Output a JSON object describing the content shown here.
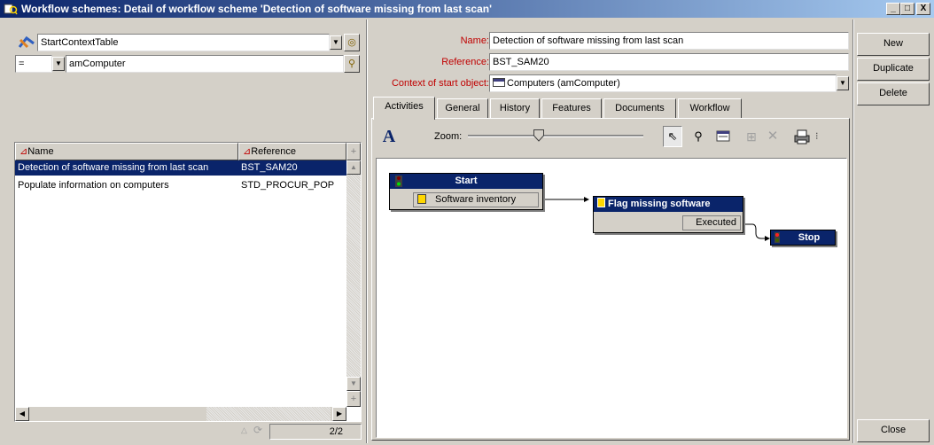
{
  "window": {
    "title": "Workflow schemes: Detail of workflow scheme 'Detection of software missing from last scan'",
    "controls": {
      "minimize": "_",
      "maximize": "□",
      "close": "X"
    }
  },
  "filter": {
    "table_value": "StartContextTable",
    "operator": "=",
    "value": "amComputer"
  },
  "list": {
    "columns": [
      "Name",
      "Reference"
    ],
    "rows": [
      {
        "name": "Detection of software missing from last scan",
        "reference": "BST_SAM20",
        "selected": true
      },
      {
        "name": "Populate information on computers",
        "reference": "STD_PROCUR_POP",
        "selected": false
      }
    ],
    "count": "2/2"
  },
  "detail": {
    "name_label": "Name:",
    "name_value": "Detection of software missing from last scan",
    "reference_label": "Reference:",
    "reference_value": "BST_SAM20",
    "context_label": "Context of start object:",
    "context_value": "Computers (amComputer)"
  },
  "tabs": [
    "Activities",
    "General",
    "History",
    "Features",
    "Documents",
    "Workflow"
  ],
  "toolbar": {
    "font_glyph": "A",
    "zoom_label": "Zoom:",
    "zoom_level": 0.4
  },
  "diagram": {
    "start_title": "Start",
    "start_event": "Software inventory",
    "activity_title": "Flag missing software",
    "activity_event": "Executed",
    "stop_title": "Stop"
  },
  "buttons": {
    "new": "New",
    "duplicate": "Duplicate",
    "delete": "Delete",
    "close": "Close"
  },
  "colors": {
    "titlebar_start": "#0a246a",
    "titlebar_end": "#a6caf0",
    "selection": "#0a246a",
    "required_label": "#c00000"
  }
}
